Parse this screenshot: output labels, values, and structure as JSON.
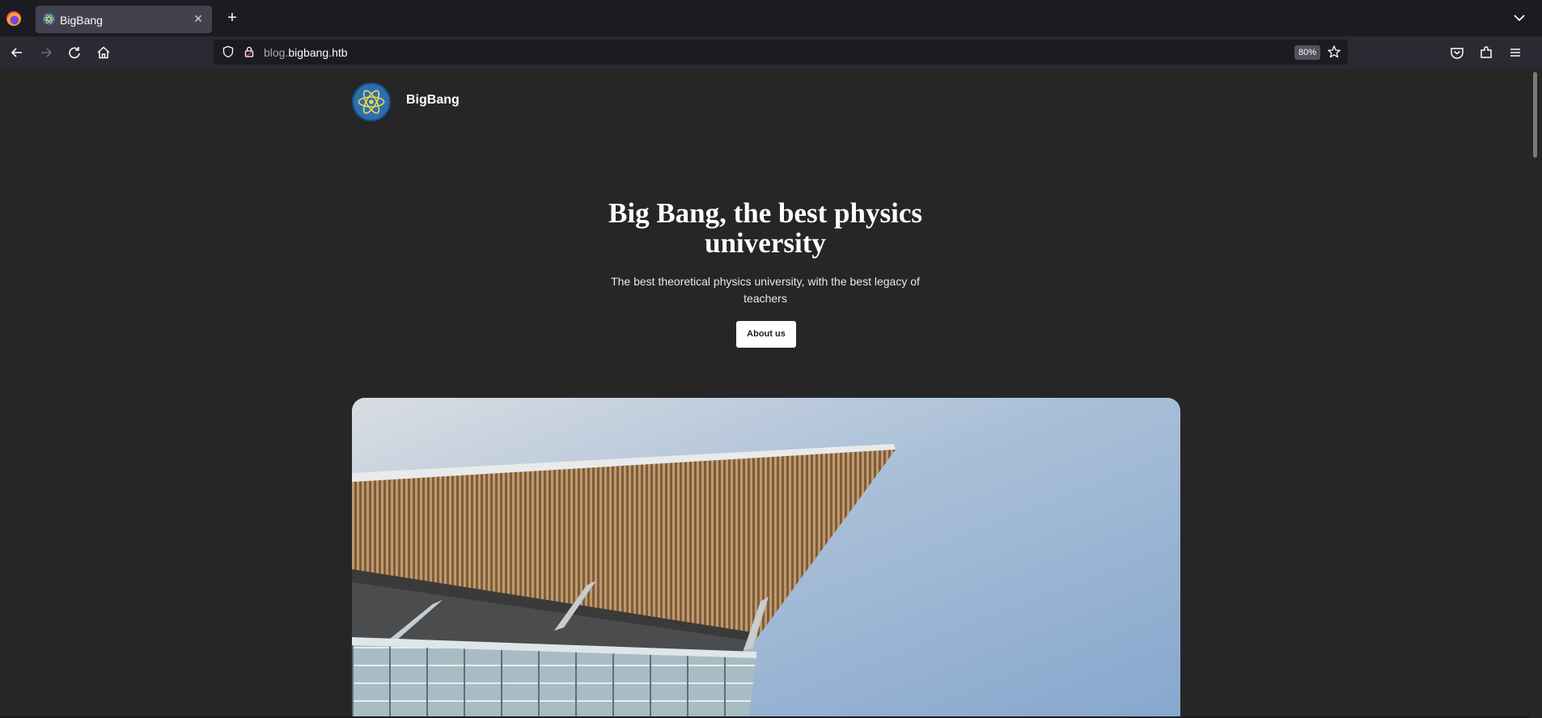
{
  "browser": {
    "tab_title": "BigBang",
    "url_subdomain": "blog.",
    "url_domain": "bigbang.htb",
    "zoom": "80%",
    "icons": [
      "firefox-icon",
      "back-icon",
      "forward-icon",
      "reload-icon",
      "home-icon",
      "shield-icon",
      "lock-icon",
      "star-icon",
      "pocket-icon",
      "extensions-icon",
      "menu-icon"
    ]
  },
  "site": {
    "name": "BigBang",
    "logo": "atom-logo"
  },
  "hero": {
    "title": "Big Bang, the best physics university",
    "subtitle": "The best theoretical physics university, with the best legacy of teachers",
    "button_label": "About us"
  },
  "image": {
    "subject": "modern building roof",
    "colors": {
      "sky": "#8fb0d4",
      "slats": "#a6835e",
      "glass": "#9fb4bc"
    }
  }
}
